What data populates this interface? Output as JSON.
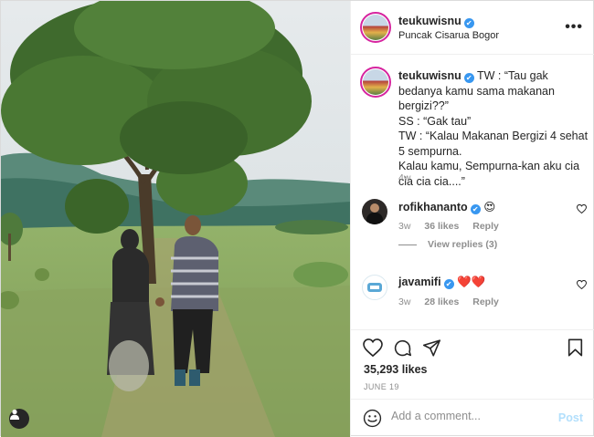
{
  "post": {
    "author": "teukuwisnu",
    "location": "Puncak Cisarua Bogor",
    "caption": "TW : “Tau gak bedanya kamu sama makanan bergizi??”\nSS : “Gak tau”\nTW : “Kalau Makanan Bergizi 4 sehat 5 sempurna.\nKalau kamu, Sempurna-kan aku cia cia cia cia....”",
    "caption_time": "4w",
    "verified_glyph": "✔",
    "more_glyph": "•••"
  },
  "comments": [
    {
      "user": "rofikhananto",
      "text": "😍",
      "time": "3w",
      "likes": "36 likes",
      "reply": "Reply",
      "view_replies": "View replies (3)"
    },
    {
      "user": "javamifi",
      "text": "❤️❤️",
      "time": "3w",
      "likes": "28 likes",
      "reply": "Reply"
    }
  ],
  "actions": {
    "likes": "35,293 likes",
    "date": "JUNE 19"
  },
  "add_comment": {
    "placeholder": "Add a comment...",
    "post_label": "Post"
  },
  "icons": {
    "like": "heart-outline-icon",
    "comment": "speech-bubble-icon",
    "share": "paper-plane-icon",
    "save": "bookmark-icon",
    "emoji": "smiley-icon",
    "user_tag": "person-icon"
  }
}
